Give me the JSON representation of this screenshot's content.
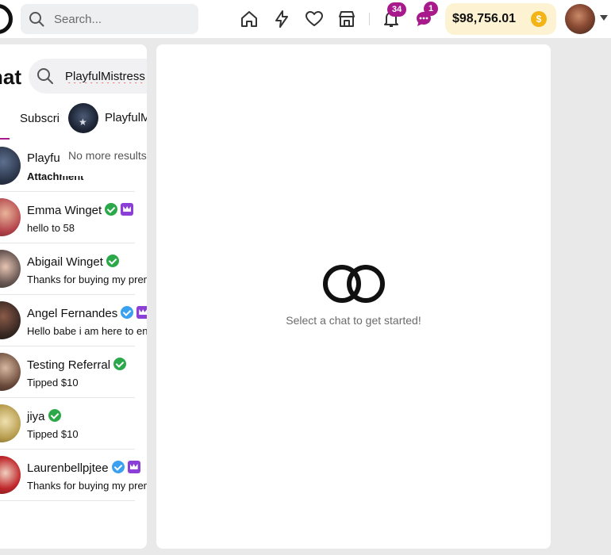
{
  "header": {
    "search_placeholder": "Search...",
    "notifications_badge": "34",
    "messages_badge": "1",
    "balance": "$98,756.01"
  },
  "sidebar": {
    "title": "hat",
    "search_value": "PlayfulMistress",
    "tab_label": "Subscri",
    "dropdown": {
      "result_name": "PlayfulM",
      "no_more": "No more results"
    },
    "chats": [
      {
        "name": "Playfu",
        "message": "Attachment",
        "bold": true,
        "verified": "none",
        "crown": false,
        "avatar_color": "#2a3448"
      },
      {
        "name": "Emma Winget",
        "message": "hello to 58",
        "bold": false,
        "verified": "green",
        "crown": true,
        "avatar_color": "#b3434a"
      },
      {
        "name": "Abigail Winget",
        "message": "Thanks for buying my premium",
        "bold": false,
        "verified": "green",
        "crown": false,
        "avatar_color": "#3a3a3a"
      },
      {
        "name": "Angel Fernandes",
        "message": "Hello babe i am here to enjoy",
        "bold": false,
        "verified": "blue",
        "crown": true,
        "avatar_color": "#3b2a24"
      },
      {
        "name": "Testing Referral",
        "message": "Tipped $10",
        "bold": false,
        "verified": "green",
        "crown": false,
        "avatar_color": "#6a4a3a"
      },
      {
        "name": "jiya",
        "message": "Tipped $10",
        "bold": false,
        "verified": "green",
        "crown": false,
        "avatar_color": "#b59a4a"
      },
      {
        "name": "Laurenbellpjtee",
        "message": "Thanks for buying my premium",
        "bold": false,
        "verified": "blue",
        "crown": true,
        "avatar_color": "#c0282c"
      }
    ]
  },
  "main": {
    "empty_text": "Select a chat to get started!"
  }
}
